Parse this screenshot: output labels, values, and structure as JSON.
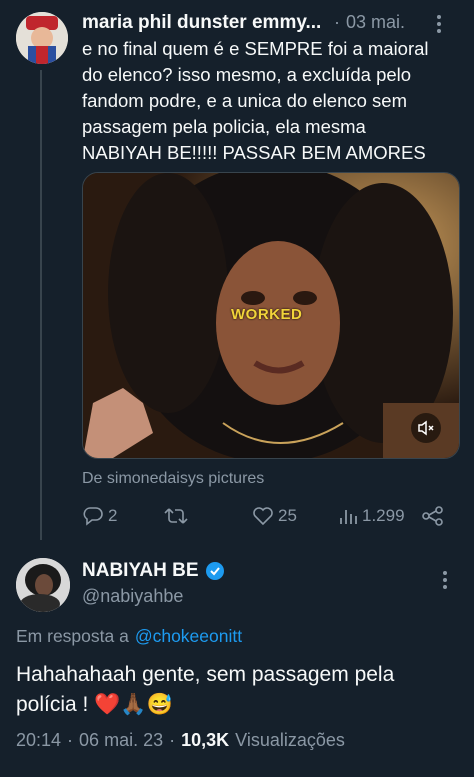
{
  "reply_tweet": {
    "author_name": "maria phil dunster emmy...",
    "separator": "·",
    "date": "03 mai.",
    "text_lines": [
      "e no final quem é e SEMPRE foi a maioral",
      "do elenco? isso mesmo, a excluída pelo",
      "fandom podre, e a unica do elenco sem",
      "passagem pela policia, ela mesma",
      "NABIYAH BE!!!!! PASSAR BEM AMORES"
    ],
    "media_overlay_text": "WORKED",
    "media_source": "De simonedaisys pictures",
    "actions": {
      "replies": "2",
      "retweets": "",
      "likes": "25",
      "views": "1.299"
    }
  },
  "main_tweet": {
    "author_name": "NABIYAH BE",
    "handle": "@nabiyahbe",
    "reply_prefix": "Em resposta a",
    "reply_to": "@chokeeonitt",
    "text_line1": "Hahahahaah gente, sem passagem pela",
    "text_line2": "polícia !",
    "emojis": "❤️🙏🏾😅",
    "time": "20:14",
    "dot1": "·",
    "date": "06 mai. 23",
    "dot2": "·",
    "views_count": "10,3K",
    "views_label": "Visualizações"
  },
  "colors": {
    "background": "#15202b",
    "text": "#f7f9f9",
    "muted": "#8b98a5",
    "link": "#1d9bf0",
    "verified": "#1d9bf0",
    "divider": "#38444d"
  }
}
